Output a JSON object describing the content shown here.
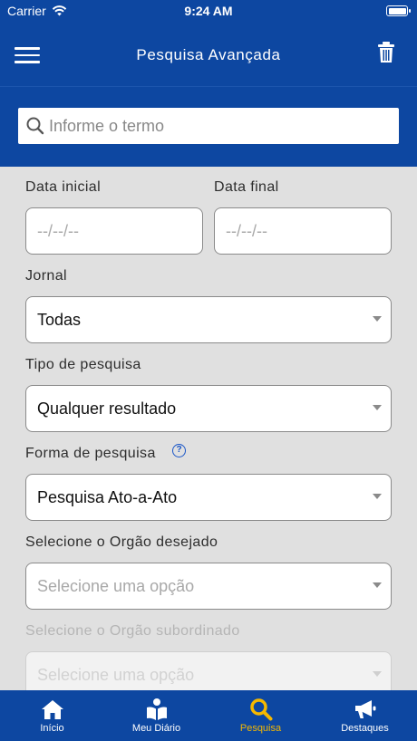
{
  "status_bar": {
    "carrier": "Carrier",
    "time": "9:24 AM"
  },
  "header": {
    "title": "Pesquisa Avançada",
    "menu_icon": "hamburger-icon",
    "delete_icon": "trash-icon"
  },
  "search": {
    "placeholder": "Informe o termo",
    "value": ""
  },
  "form": {
    "start_date": {
      "label": "Data inicial",
      "placeholder": "--/--/--"
    },
    "end_date": {
      "label": "Data final",
      "placeholder": "--/--/--"
    },
    "journal": {
      "label": "Jornal",
      "value": "Todas"
    },
    "search_type": {
      "label": "Tipo de pesquisa",
      "value": "Qualquer resultado"
    },
    "search_form": {
      "label": "Forma de pesquisa",
      "help": "?",
      "value": "Pesquisa Ato-a-Ato"
    },
    "organ": {
      "label": "Selecione o Orgão desejado",
      "placeholder": "Selecione uma opção"
    },
    "sub_organ": {
      "label": "Selecione o Orgão subordinado",
      "placeholder": "Selecione uma opção"
    }
  },
  "tab_bar": {
    "active_color": "#f5b800",
    "items": [
      {
        "label": "Início",
        "icon": "home-icon"
      },
      {
        "label": "Meu Diário",
        "icon": "book-reader-icon"
      },
      {
        "label": "Pesquisa",
        "icon": "search-icon",
        "active": true
      },
      {
        "label": "Destaques",
        "icon": "megaphone-icon"
      }
    ]
  }
}
